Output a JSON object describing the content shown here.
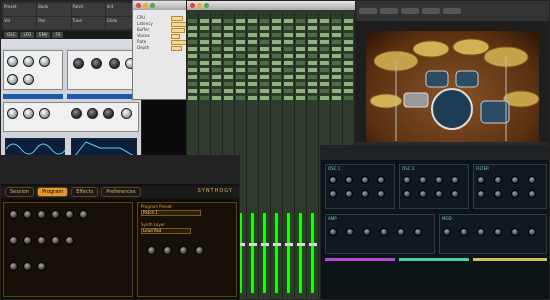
{
  "windows": {
    "synth_a": {
      "tabs": [
        "OSC",
        "LFO",
        "ENV",
        "FX"
      ],
      "header_fields": [
        "Preset",
        "Bank",
        "Patch",
        "Init",
        "Vol",
        "Pan",
        "Tune",
        "Glide"
      ]
    },
    "dialog_b": {
      "rows": [
        "CPU",
        "Latency",
        "Buffer",
        "Voices",
        "Rate",
        "Depth"
      ]
    },
    "program_e": {
      "tabs": [
        "Session",
        "Program",
        "Effects",
        "Preferences"
      ],
      "active_tab": "Program",
      "fields": [
        "Program Preset",
        "Synth Layer",
        "Lead Pad",
        "Patch 1"
      ],
      "logo": "SYNTHOGY"
    },
    "synth_f": {
      "sections": [
        "OSC 1",
        "OSC 2",
        "FILTER",
        "AMP",
        "MOD"
      ]
    }
  },
  "colors": {
    "program_accent": "#e29a2a",
    "mixer_insert": "#8fb37a",
    "synth_f_accent": "#6fd6c6",
    "synth_a_blue": "#1c59a8"
  },
  "icons": [
    "close-icon",
    "minimize-icon",
    "zoom-icon",
    "knob-icon",
    "cymbal-icon"
  ]
}
